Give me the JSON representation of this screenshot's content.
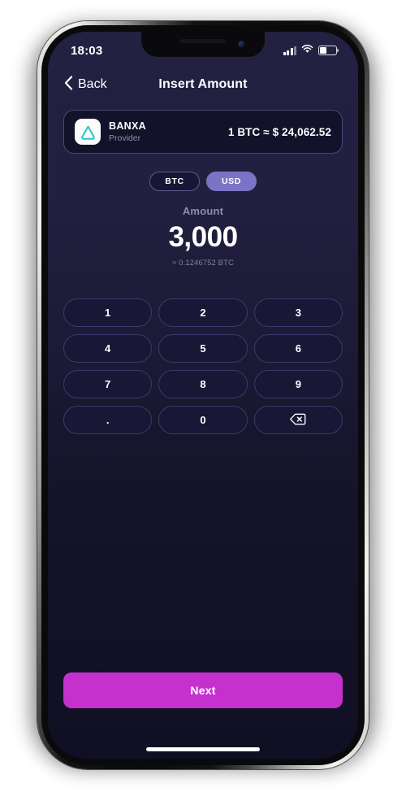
{
  "status_bar": {
    "time": "18:03",
    "signal_icon": "cellular-signal-icon",
    "wifi_icon": "wifi-icon",
    "battery_icon": "battery-icon",
    "battery_level_percent": 40
  },
  "header": {
    "back_label": "Back",
    "back_icon": "chevron-left-icon",
    "title": "Insert Amount"
  },
  "provider": {
    "logo_icon": "banxa-triangle-logo-icon",
    "name": "BANXA",
    "subtitle": "Provider",
    "rate": "1 BTC ≈ $ 24,062.52"
  },
  "currency_toggle": {
    "options": [
      {
        "label": "BTC",
        "selected": false
      },
      {
        "label": "USD",
        "selected": true
      }
    ]
  },
  "amount": {
    "label": "Amount",
    "value": "3,000",
    "converted": "≈ 0.1246752 BTC"
  },
  "keypad": {
    "keys": [
      {
        "label": "1",
        "name": "key-1"
      },
      {
        "label": "2",
        "name": "key-2"
      },
      {
        "label": "3",
        "name": "key-3"
      },
      {
        "label": "4",
        "name": "key-4"
      },
      {
        "label": "5",
        "name": "key-5"
      },
      {
        "label": "6",
        "name": "key-6"
      },
      {
        "label": "7",
        "name": "key-7"
      },
      {
        "label": "8",
        "name": "key-8"
      },
      {
        "label": "9",
        "name": "key-9"
      },
      {
        "label": ".",
        "name": "key-decimal"
      },
      {
        "label": "0",
        "name": "key-0"
      },
      {
        "label": "",
        "name": "key-backspace",
        "icon": "backspace-icon"
      }
    ]
  },
  "footer": {
    "next_label": "Next"
  },
  "colors": {
    "background_top": "#232142",
    "background_bottom": "#101024",
    "accent_magenta": "#c531cd",
    "toggle_selected": "#7b74c6",
    "logo_teal": "#2ec5c8",
    "card_border": "#4a4775",
    "key_border": "#3b3a6b"
  }
}
